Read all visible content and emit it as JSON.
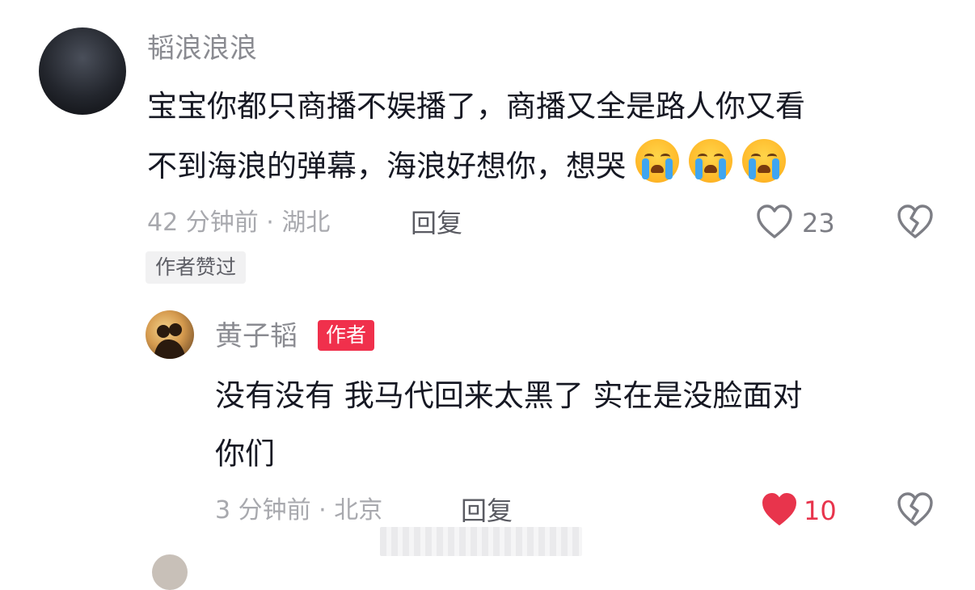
{
  "comment": {
    "username": "韬浪浪浪",
    "text_line1": "宝宝你都只商播不娱播了，商播又全是路人你又看",
    "text_line2": "不到海浪的弹幕，海浪好想你，想哭",
    "emoji_icon": "loudly-crying-face",
    "emoji_count": 3,
    "meta": "42 分钟前 · 湖北",
    "reply_label": "回复",
    "like_count": "23",
    "author_liked_badge": "作者赞过"
  },
  "reply": {
    "username": "黄子韬",
    "author_badge": "作者",
    "text_line1": "没有没有 我马代回来太黑了 实在是没脸面对",
    "text_line2": "你们",
    "meta": "3 分钟前 · 北京",
    "reply_label": "回复",
    "like_count": "10",
    "liked": true
  },
  "colors": {
    "liked": "#e8344c",
    "author_badge_bg": "#f0304c"
  }
}
